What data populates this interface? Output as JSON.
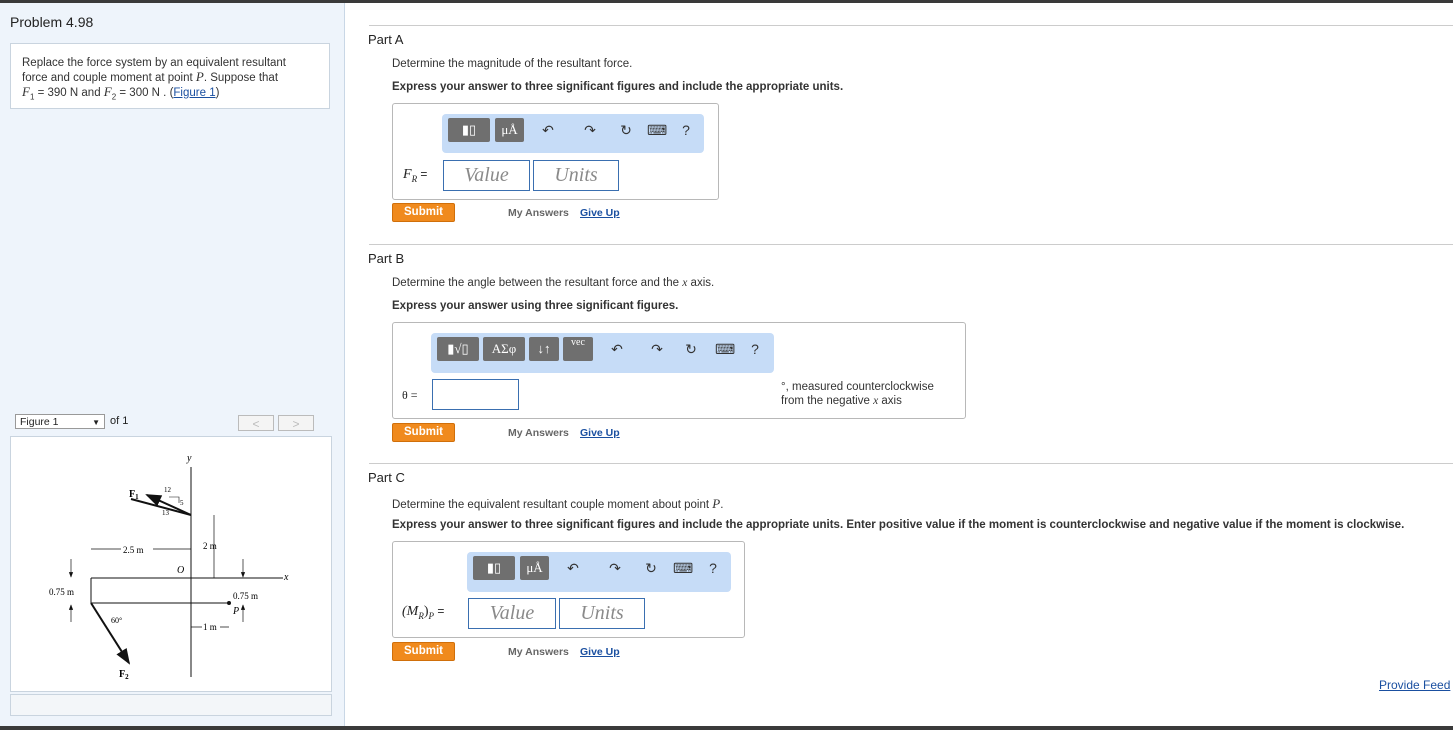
{
  "problem": {
    "title": "Problem 4.98",
    "text_line1": "Replace the force system by an equivalent resultant",
    "text_line2_prefix": "force and couple moment at point ",
    "point": "P",
    "text_line2_suffix": ". Suppose that",
    "f1_sym": "F",
    "f1_sub": "1",
    "f1_value": " = 390  N",
    "and": " and ",
    "f2_sym": "F",
    "f2_sub": "2",
    "f2_value": " = 300  N",
    "dot": " . (",
    "figure_link": "Figure 1",
    "close": ")"
  },
  "figure": {
    "selected": "Figure 1",
    "of": "of 1",
    "prev": "<",
    "next": ">",
    "labels": {
      "y": "y",
      "x": "x",
      "F1": "F",
      "F1sub": "1",
      "F2": "F",
      "F2sub": "2",
      "O": "O",
      "P": "P",
      "d12": "12",
      "d5": "5",
      "d13": "13",
      "d25": "2.5 m",
      "d2": "2 m",
      "d075a": "0.75 m",
      "d075b": "0.75 m",
      "d1": "1 m",
      "a60": "60°"
    }
  },
  "partA": {
    "title": "Part A",
    "question": "Determine the magnitude of the resultant force.",
    "instruction": "Express your answer to three significant figures and include the appropriate units.",
    "label": "F",
    "label_sub": "R",
    "label_eq": " =",
    "value_placeholder": "Value",
    "units_placeholder": "Units",
    "submit": "Submit",
    "my_answers": "My Answers",
    "give_up": "Give Up"
  },
  "partB": {
    "title": "Part B",
    "question_prefix": "Determine the angle between the resultant force and the ",
    "question_var": "x",
    "question_suffix": " axis.",
    "instruction": "Express your answer using three significant figures.",
    "label": "θ =",
    "unit_line1": "°, measured counterclockwise",
    "unit_line2_prefix": "from the negative ",
    "unit_line2_var": "x",
    "unit_line2_suffix": " axis",
    "submit": "Submit",
    "my_answers": "My Answers",
    "give_up": "Give Up"
  },
  "partC": {
    "title": "Part C",
    "question_prefix": "Determine the equivalent resultant couple moment about point ",
    "question_var": "P",
    "question_suffix": ".",
    "instruction": "Express your answer to three significant figures and include the appropriate units. Enter positive value if the moment is counterclockwise and negative value if the moment is clockwise.",
    "label_open": "(M",
    "label_sub": "R",
    "label_close": ")",
    "label_psub": "P",
    "label_eq": " =",
    "value_placeholder": "Value",
    "units_placeholder": "Units",
    "submit": "Submit",
    "my_answers": "My Answers",
    "give_up": "Give Up"
  },
  "toolbar": {
    "mu_a": "μÅ",
    "greek": "ΑΣφ",
    "vec": "vec",
    "help": "?"
  },
  "footer": {
    "provide_feedback": "Provide Feed"
  },
  "colors": {
    "submit": "#f08a1d",
    "link": "#1a4fa0",
    "toolbar_bg": "#c6dcf7",
    "left_panel_bg": "#eef4fb"
  }
}
